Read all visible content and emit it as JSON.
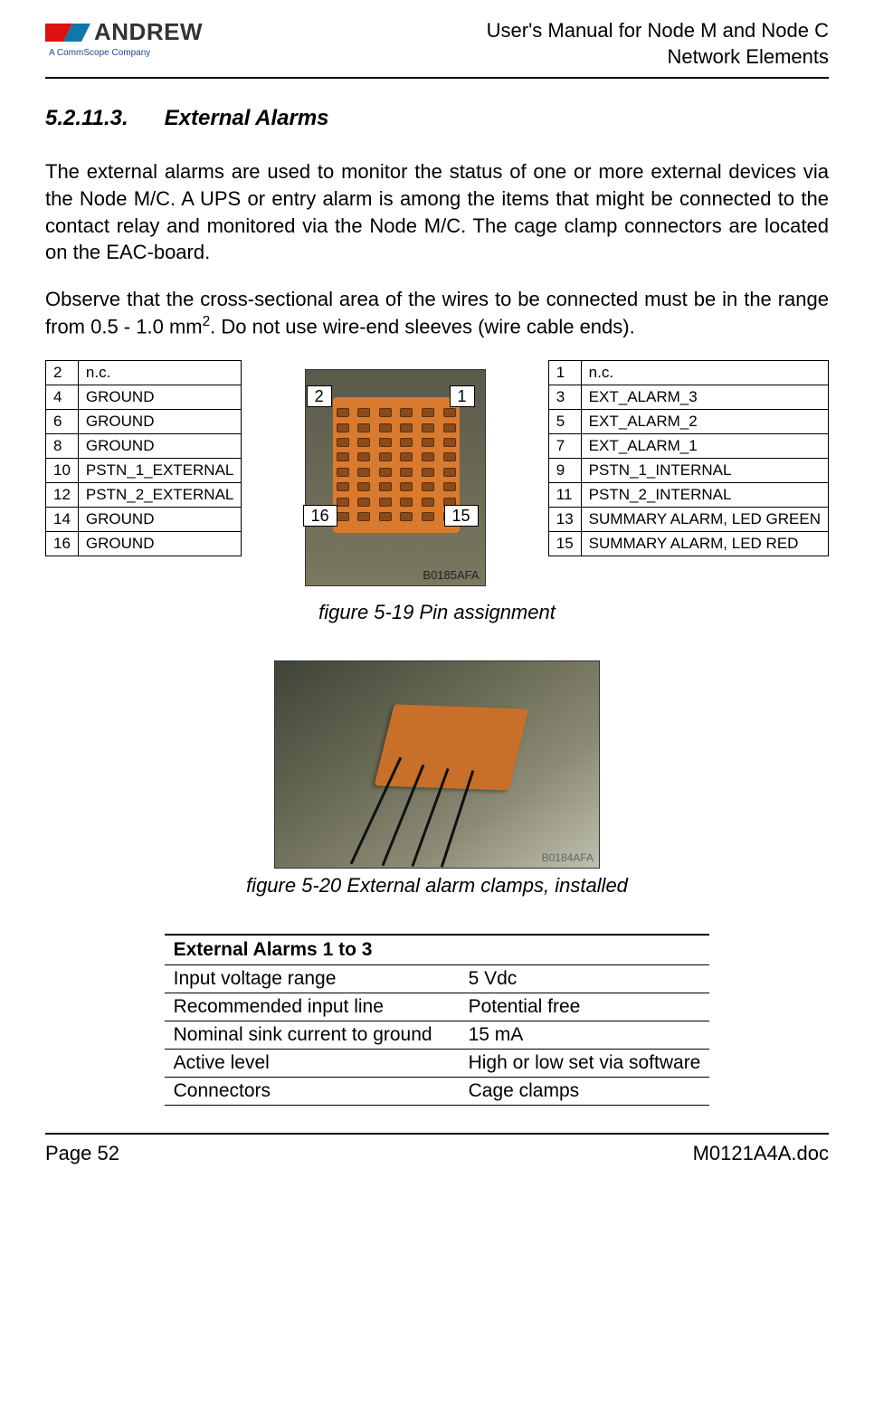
{
  "logo": {
    "brand": "ANDREW",
    "sub": "A CommScope Company"
  },
  "header": {
    "line1": "User's Manual for Node M and Node C",
    "line2": "Network Elements"
  },
  "section": {
    "number": "5.2.11.3.",
    "title": "External Alarms"
  },
  "paragraphs": {
    "p1": "The external alarms are used to monitor the status of one or more external devices via the Node M/C. A UPS or entry alarm is among the items that might be connected to the contact relay and monitored via the Node M/C. The cage clamp connectors are located on the EAC-board.",
    "p2a": "Observe that the cross-sectional area of the wires to be connected must be in the range from 0.5 - 1.0 mm",
    "p2sup": "2",
    "p2b": ". Do not use wire-end sleeves (wire cable ends)."
  },
  "pin_left": [
    {
      "n": "2",
      "label": "n.c."
    },
    {
      "n": "4",
      "label": "GROUND"
    },
    {
      "n": "6",
      "label": "GROUND"
    },
    {
      "n": "8",
      "label": "GROUND"
    },
    {
      "n": "10",
      "label": "PSTN_1_EXTERNAL"
    },
    {
      "n": "12",
      "label": "PSTN_2_EXTERNAL"
    },
    {
      "n": "14",
      "label": "GROUND"
    },
    {
      "n": "16",
      "label": "GROUND"
    }
  ],
  "pin_right": [
    {
      "n": "1",
      "label": "n.c."
    },
    {
      "n": "3",
      "label": "EXT_ALARM_3"
    },
    {
      "n": "5",
      "label": "EXT_ALARM_2"
    },
    {
      "n": "7",
      "label": "EXT_ALARM_1"
    },
    {
      "n": "9",
      "label": "PSTN_1_INTERNAL"
    },
    {
      "n": "11",
      "label": "PSTN_2_INTERNAL"
    },
    {
      "n": "13",
      "label": "SUMMARY ALARM, LED GREEN"
    },
    {
      "n": "15",
      "label": "SUMMARY ALARM, LED RED"
    }
  ],
  "connector_labels": {
    "tl": "2",
    "tr": "1",
    "bl": "16",
    "br": "15"
  },
  "figure_ids": {
    "fig1": "B0185AFA",
    "fig2": "B0184AFA"
  },
  "captions": {
    "fig1": "figure 5-19 Pin assignment",
    "fig2": "figure 5-20 External alarm clamps, installed"
  },
  "spec_table": {
    "header": "External Alarms 1 to 3",
    "rows": [
      {
        "k": "Input voltage range",
        "v": "5 Vdc"
      },
      {
        "k": "Recommended input line",
        "v": "Potential free"
      },
      {
        "k": "Nominal sink current to ground",
        "v": "15 mA"
      },
      {
        "k": "Active level",
        "v": "High or low set via software"
      },
      {
        "k": "Connectors",
        "v": "Cage clamps"
      }
    ]
  },
  "footer": {
    "left": "Page 52",
    "right": "M0121A4A.doc"
  }
}
